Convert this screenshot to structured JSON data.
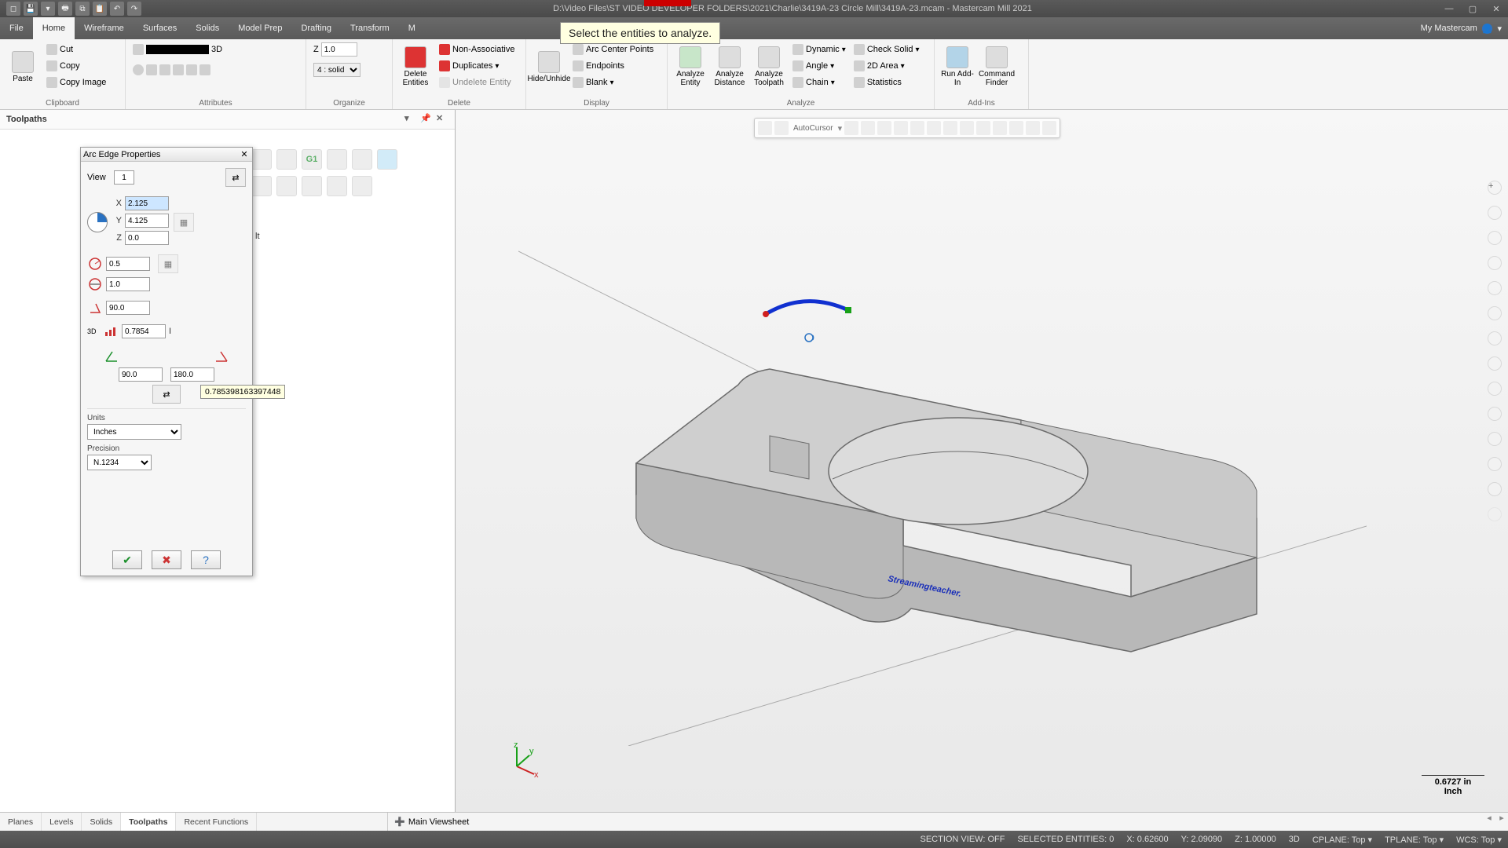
{
  "title": "D:\\Video Files\\ST VIDEO DEVELOPER FOLDERS\\2021\\Charlie\\3419A-23 Circle Mill\\3419A-23.mcam - Mastercam Mill 2021",
  "prompt": "Select the entities to analyze.",
  "tabs": {
    "file": "File",
    "home": "Home",
    "wireframe": "Wireframe",
    "surfaces": "Surfaces",
    "solids": "Solids",
    "modelprep": "Model Prep",
    "drafting": "Drafting",
    "transform": "Transform",
    "m": "M",
    "mymc": "My Mastercam"
  },
  "ribbon": {
    "clipboard": {
      "label": "Clipboard",
      "paste": "Paste",
      "cut": "Cut",
      "copy": "Copy",
      "copyimg": "Copy Image"
    },
    "attributes": {
      "label": "Attributes",
      "z": "Z",
      "zval": "1.0",
      "mode3d": "3D",
      "sel": "4 : solid"
    },
    "organize": {
      "label": "Organize"
    },
    "delete": {
      "label": "Delete",
      "del": "Delete Entities",
      "nonassoc": "Non-Associative",
      "dup": "Duplicates",
      "undel": "Undelete Entity"
    },
    "display": {
      "label": "Display",
      "hide": "Hide/Unhide",
      "arcctr": "Arc Center Points",
      "endpts": "Endpoints",
      "blank": "Blank"
    },
    "analyze": {
      "label": "Analyze",
      "entity": "Analyze Entity",
      "distance": "Analyze Distance",
      "toolpath": "Analyze Toolpath",
      "dynamic": "Dynamic",
      "angle": "Angle",
      "chain": "Chain",
      "checksolid": "Check Solid",
      "area2d": "2D Area",
      "stats": "Statistics"
    },
    "addins": {
      "label": "Add-Ins",
      "run": "Run Add-In",
      "cmd": "Command Finder"
    }
  },
  "panel": {
    "title": "Toolpaths"
  },
  "dialog": {
    "title": "Arc Edge Properties",
    "view": "View",
    "viewnum": "1",
    "x": "2.125",
    "y": "4.125",
    "z": "0.0",
    "radius": "0.5",
    "diameter": "1.0",
    "sweep": "90.0",
    "len3d_lbl": "3D",
    "len3d": "0.7854",
    "len3d_tip": "0.785398163397448",
    "start_angle": "90.0",
    "end_angle": "180.0",
    "units_lbl": "Units",
    "units": "Inches",
    "precision_lbl": "Precision",
    "precision": "N.1234",
    "partial_lt": "lt"
  },
  "viewport": {
    "autocursor": "AutoCursor",
    "scale_val": "0.6727 in",
    "scale_unit": "Inch",
    "engrave": "Streamingteacher."
  },
  "bottom": {
    "planes": "Planes",
    "levels": "Levels",
    "solids": "Solids",
    "toolpaths": "Toolpaths",
    "recent": "Recent Functions",
    "viewsheet": "Main Viewsheet"
  },
  "status": {
    "section": "SECTION VIEW: OFF",
    "selected": "SELECTED ENTITIES: 0",
    "x": "X: 0.62600",
    "y": "Y: 2.09090",
    "z": "Z: 1.00000",
    "mode": "3D",
    "cplane": "CPLANE: Top",
    "tplane": "TPLANE: Top",
    "wcs": "WCS: Top"
  }
}
